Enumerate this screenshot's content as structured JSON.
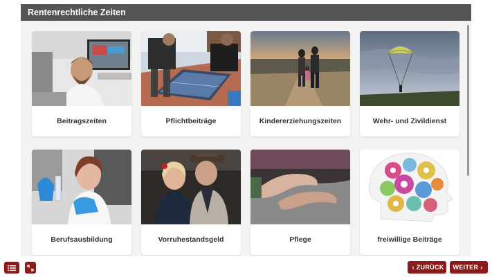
{
  "panel": {
    "title": "Rentenrechtliche Zeiten"
  },
  "cards": [
    {
      "label": "Beitragszeiten"
    },
    {
      "label": "Pflichtbeiträge"
    },
    {
      "label": "Kindererziehungszeiten"
    },
    {
      "label": "Wehr- und Zivildienst"
    },
    {
      "label": "Berufsausbildung"
    },
    {
      "label": "Vorruhestandsgeld"
    },
    {
      "label": "Pflege"
    },
    {
      "label": "freiwillige Beiträge"
    }
  ],
  "footer": {
    "back_label": "ZURÜCK",
    "next_label": "WEITER",
    "accent": "#8b1a1a"
  }
}
